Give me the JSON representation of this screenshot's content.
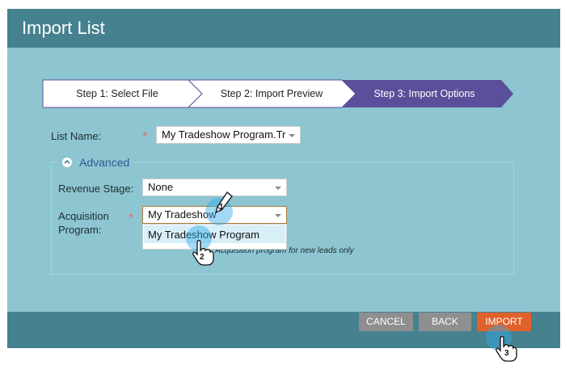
{
  "window": {
    "title": "Import List"
  },
  "steps": [
    {
      "label": "Step 1: Select File",
      "state": "done"
    },
    {
      "label": "Step 2: Import Preview",
      "state": "done"
    },
    {
      "label": "Step 3: Import Options",
      "state": "active"
    }
  ],
  "form": {
    "list_name_label": "List Name:",
    "list_name_value": "My Tradeshow Program.Tr",
    "advanced_label": "Advanced",
    "revenue_stage_label": "Revenue Stage:",
    "revenue_stage_value": "None",
    "acquisition_label_line1": "Acquisition",
    "acquisition_label_line2": "Program:",
    "acquisition_value": "My Tradeshow",
    "acquisition_option": "My Tradeshow Program",
    "acquisition_hint": "Acquisition program for new leads only",
    "required_mark": "*"
  },
  "footer": {
    "cancel_label": "CANCEL",
    "back_label": "BACK",
    "import_label": "IMPORT"
  },
  "annotations": {
    "step1": "1",
    "step2": "2",
    "step3": "3"
  },
  "colors": {
    "header": "#46818f",
    "panel": "#8dc5d1",
    "step_active": "#5b4e9a",
    "import_button": "#e0612b",
    "link": "#2a5f8f"
  }
}
